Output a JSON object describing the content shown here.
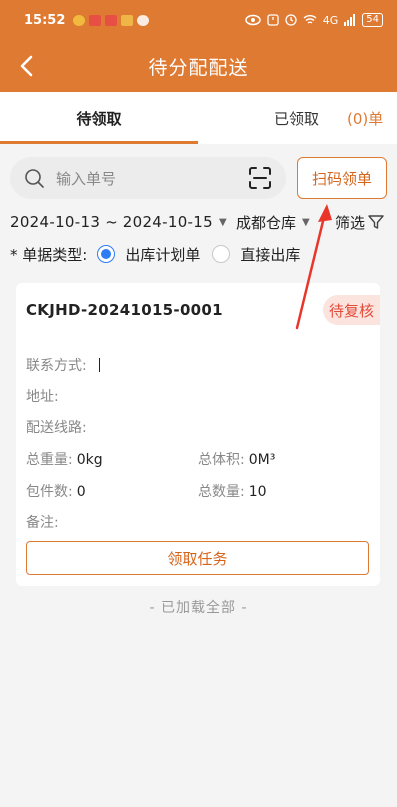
{
  "status_bar": {
    "time": "15:52",
    "network": "4G",
    "battery": "54"
  },
  "header": {
    "title": "待分配配送"
  },
  "tabs": {
    "pending_label": "待领取",
    "received_label": "已领取",
    "received_count": "(0)单"
  },
  "search": {
    "placeholder": "输入单号",
    "scan_button_label": "扫码领单"
  },
  "filter": {
    "start_date": "2024-10-13",
    "separator": "~",
    "end_date": "2024-10-15",
    "warehouse": "成都仓库",
    "filter_label": "筛选"
  },
  "doc_type": {
    "label": "* 单据类型:",
    "options": [
      "出库计划单",
      "直接出库"
    ],
    "selected": "出库计划单"
  },
  "order": {
    "number": "CKJHD-20241015-0001",
    "status": "待复核",
    "contact_label": "联系方式:",
    "contact_value": "",
    "address_label": "地址:",
    "address_value": "",
    "route_label": "配送线路:",
    "route_value": "",
    "weight_label": "总重量:",
    "weight_value": "0kg",
    "volume_label": "总体积:",
    "volume_value": "0M³",
    "packages_label": "包件数:",
    "packages_value": "0",
    "quantity_label": "总数量:",
    "quantity_value": "10",
    "remark_label": "备注:",
    "remark_value": "",
    "claim_button_label": "领取任务"
  },
  "footer_text": "- 已加载全部 -",
  "colors": {
    "brand_orange": "#df7a33",
    "badge_red": "#e34b3a",
    "radio_blue": "#2d7cf6",
    "annotation_arrow": "#e8362b"
  }
}
